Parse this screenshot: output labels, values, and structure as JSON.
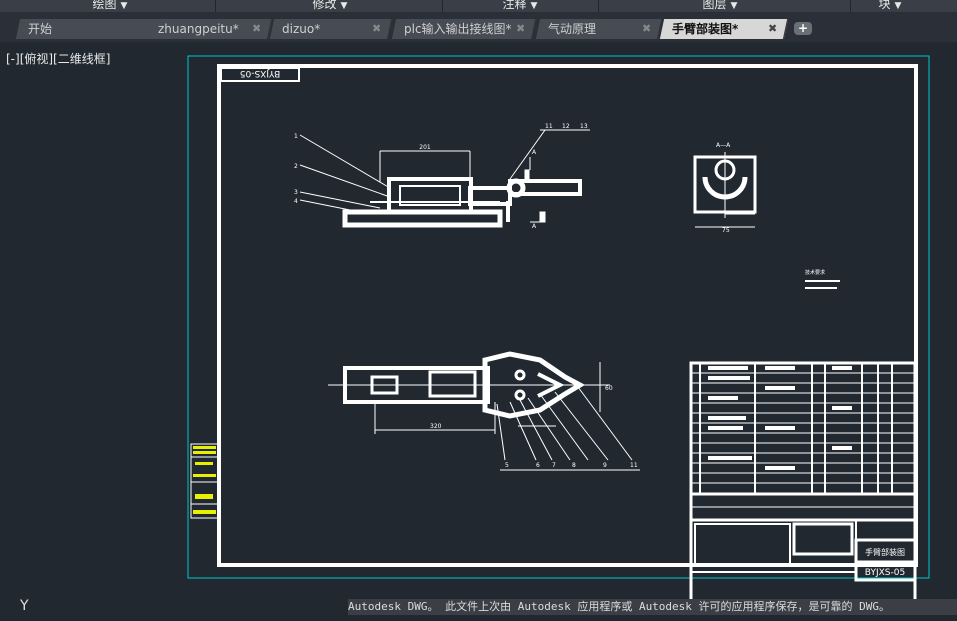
{
  "ribbon": {
    "panels": [
      {
        "label": "绘图",
        "id": "draw"
      },
      {
        "label": "修改",
        "id": "modify"
      },
      {
        "label": "注释",
        "id": "annotate"
      },
      {
        "label": "图层",
        "id": "layers"
      },
      {
        "label": "块",
        "id": "block"
      }
    ],
    "dropdown_glyph": "▼"
  },
  "tabs": [
    {
      "label": "开始",
      "closable": false,
      "active": false
    },
    {
      "label": "zhuangpeitu*",
      "closable": true,
      "active": false
    },
    {
      "label": "dizuo*",
      "closable": true,
      "active": false
    },
    {
      "label": "plc输入输出接线图*",
      "closable": true,
      "active": false
    },
    {
      "label": "气动原理",
      "closable": true,
      "active": false
    },
    {
      "label": "手臂部装图*",
      "closable": true,
      "active": true
    }
  ],
  "close_glyph": "✖",
  "new_tab_glyph": "+",
  "viewport": {
    "view_label": "[-][俯视][二维线框]",
    "ucs_label": "Y"
  },
  "drawing": {
    "title_block_code_rotated": "BYJXS-05",
    "drawing_name": "手臂部装图",
    "drawing_code": "BYJXS-05",
    "dim_top": "201",
    "dim_bottom": "320",
    "dim_section": "75",
    "section_label": "A—A",
    "callouts_top": [
      "1",
      "2",
      "3",
      "4"
    ],
    "callouts_top_right": [
      "11",
      "12",
      "13"
    ],
    "callouts_bottom": [
      "5",
      "6",
      "7",
      "8",
      "9",
      "11"
    ],
    "notes_title": "技术要求"
  },
  "status": {
    "message": "Autodesk DWG。  此文件上次由 Autodesk 应用程序或 Autodesk 许可的应用程序保存，是可靠的 DWG。"
  },
  "colors": {
    "background": "#212830",
    "drawing_lines": "#ffffff",
    "layout_border": "#00c8c8",
    "layer_highlight": "#e6f000",
    "active_tab": "#d7d7d7"
  }
}
